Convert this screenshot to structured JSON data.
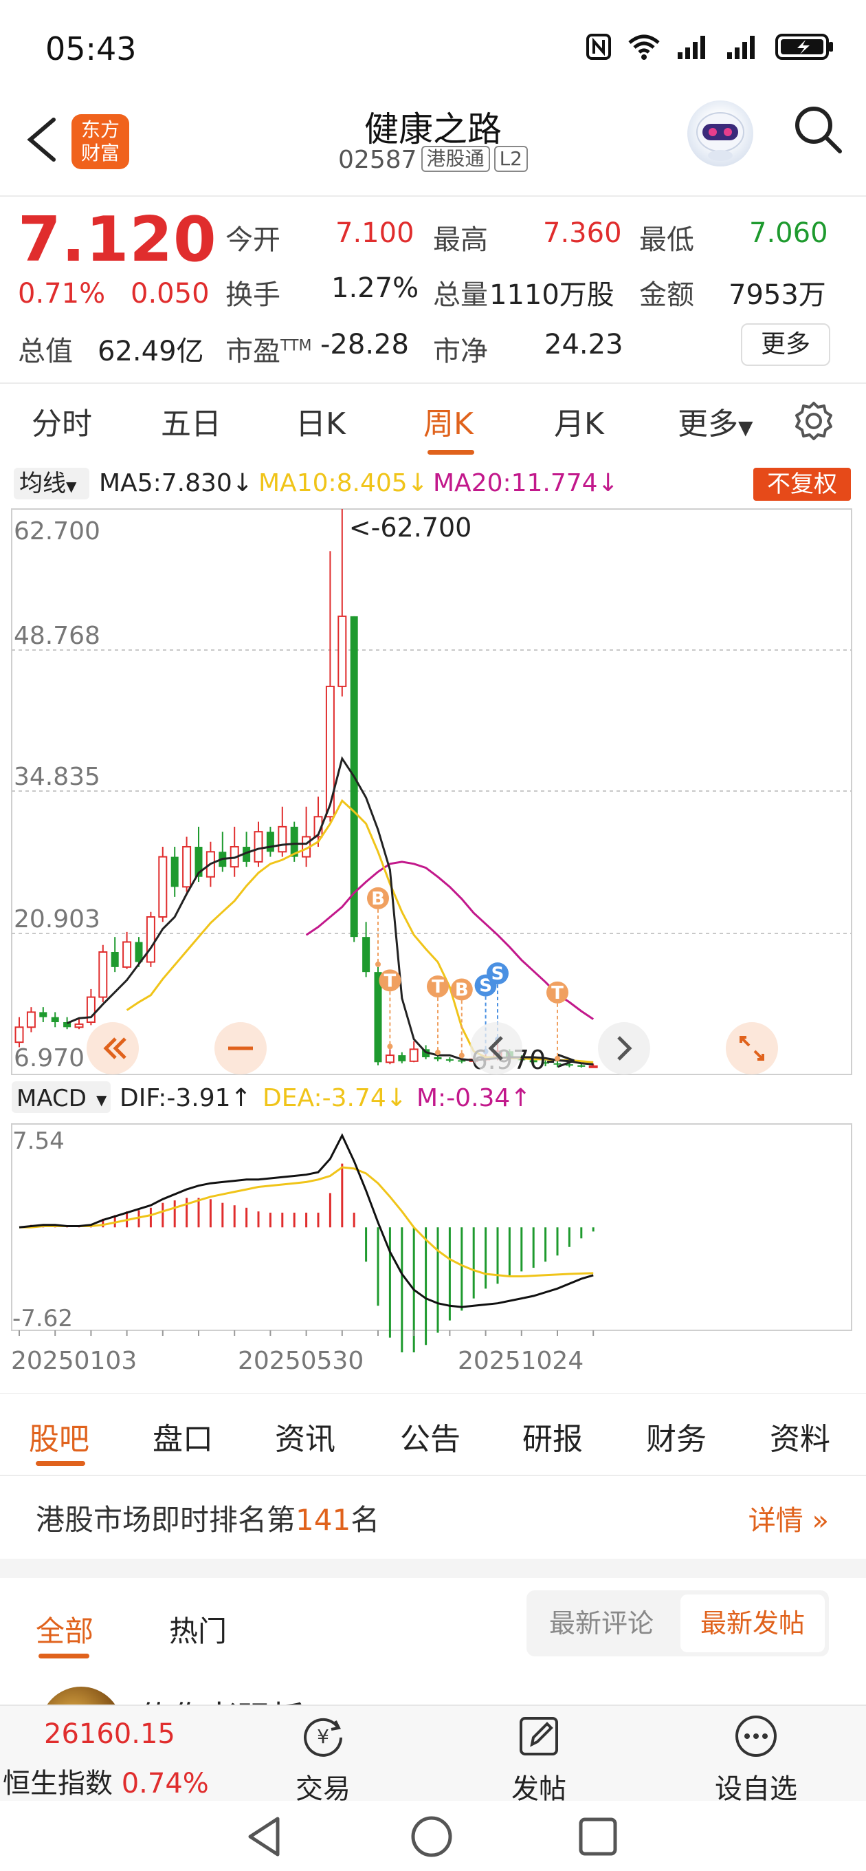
{
  "status_bar": {
    "time": "05:43"
  },
  "header": {
    "stock_name": "健康之路",
    "stock_code": "02587",
    "tag_connect": "港股通",
    "tag_level": "L2",
    "logo_text_1": "东方",
    "logo_text_2": "财富"
  },
  "quote": {
    "price": "7.120",
    "change_pct": "0.71%",
    "change_amt": "0.050",
    "open_label": "今开",
    "open_value": "7.100",
    "high_label": "最高",
    "high_value": "7.360",
    "low_label": "最低",
    "low_value": "7.060",
    "turnover_label": "换手",
    "turnover_value": "1.27%",
    "volume_label": "总量",
    "volume_value": "1110万股",
    "amount_label": "金额",
    "amount_value": "7953万",
    "mktcap_label": "总值",
    "mktcap_value": "62.49亿",
    "pe_label": "市盈",
    "pe_sup": "TTM",
    "pe_value": "-28.28",
    "pb_label": "市净",
    "pb_value": "24.23",
    "more_label": "更多"
  },
  "period_tabs": [
    "分时",
    "五日",
    "日K",
    "周K",
    "月K",
    "更多"
  ],
  "ma_legend": {
    "selector": "均线",
    "ma5": "MA5:7.830↓",
    "ma10": "MA10:8.405↓",
    "ma20": "MA20:11.774↓",
    "adjust_button": "不复权"
  },
  "macd_legend": {
    "selector": "MACD",
    "dif": "DIF:-3.91↑",
    "dea": "DEA:-3.74↓",
    "m": "M:-0.34↑"
  },
  "chart_data": {
    "type": "candlestick",
    "period": "weekly",
    "price_axis_labels": [
      "62.700",
      "48.768",
      "34.835",
      "20.903",
      "6.970"
    ],
    "ylim": [
      6.97,
      62.7
    ],
    "high_marker": "<-62.700",
    "low_marker": "6.970->",
    "date_labels": [
      "20250103",
      "20250530",
      "20251024"
    ],
    "colors": {
      "up": "#e02d2d",
      "down": "#1e9a2e",
      "ma5": "#222222",
      "ma10": "#f0c419",
      "ma20": "#c2188b"
    },
    "candles": [
      {
        "o": 9.5,
        "c": 11.0,
        "h": 12.0,
        "l": 9.0
      },
      {
        "o": 11.0,
        "c": 12.5,
        "h": 13.0,
        "l": 10.5
      },
      {
        "o": 12.5,
        "c": 12.0,
        "h": 13.0,
        "l": 11.5
      },
      {
        "o": 12.0,
        "c": 11.5,
        "h": 12.5,
        "l": 11.0
      },
      {
        "o": 11.5,
        "c": 11.0,
        "h": 12.0,
        "l": 10.8
      },
      {
        "o": 11.0,
        "c": 11.3,
        "h": 11.8,
        "l": 10.8
      },
      {
        "o": 11.5,
        "c": 14.0,
        "h": 14.8,
        "l": 11.2
      },
      {
        "o": 14.0,
        "c": 18.5,
        "h": 19.2,
        "l": 13.5
      },
      {
        "o": 18.5,
        "c": 17.0,
        "h": 20.0,
        "l": 16.5
      },
      {
        "o": 17.0,
        "c": 19.5,
        "h": 20.5,
        "l": 16.8
      },
      {
        "o": 19.5,
        "c": 17.5,
        "h": 20.0,
        "l": 17.0
      },
      {
        "o": 17.5,
        "c": 22.0,
        "h": 22.5,
        "l": 17.0
      },
      {
        "o": 22.0,
        "c": 28.0,
        "h": 29.0,
        "l": 21.5
      },
      {
        "o": 28.0,
        "c": 25.0,
        "h": 29.0,
        "l": 24.0
      },
      {
        "o": 25.0,
        "c": 29.0,
        "h": 30.0,
        "l": 24.5
      },
      {
        "o": 29.0,
        "c": 26.0,
        "h": 31.0,
        "l": 25.5
      },
      {
        "o": 26.0,
        "c": 28.5,
        "h": 29.5,
        "l": 25.0
      },
      {
        "o": 28.5,
        "c": 27.0,
        "h": 30.5,
        "l": 26.5
      },
      {
        "o": 27.0,
        "c": 29.0,
        "h": 31.0,
        "l": 26.0
      },
      {
        "o": 29.0,
        "c": 27.5,
        "h": 30.5,
        "l": 27.0
      },
      {
        "o": 27.5,
        "c": 30.5,
        "h": 31.5,
        "l": 27.0
      },
      {
        "o": 30.5,
        "c": 28.5,
        "h": 31.0,
        "l": 28.0
      },
      {
        "o": 28.5,
        "c": 31.0,
        "h": 33.0,
        "l": 28.0
      },
      {
        "o": 31.0,
        "c": 28.0,
        "h": 31.5,
        "l": 27.5
      },
      {
        "o": 28.0,
        "c": 30.0,
        "h": 33.0,
        "l": 27.0
      },
      {
        "o": 30.0,
        "c": 32.0,
        "h": 34.0,
        "l": 29.0
      },
      {
        "o": 32.0,
        "c": 45.0,
        "h": 58.5,
        "l": 31.5
      },
      {
        "o": 45.0,
        "c": 52.0,
        "h": 62.7,
        "l": 44.0
      },
      {
        "o": 52.0,
        "c": 20.0,
        "h": 52.0,
        "l": 19.5
      },
      {
        "o": 20.0,
        "c": 16.5,
        "h": 21.5,
        "l": 16.0
      },
      {
        "o": 16.5,
        "c": 7.5,
        "h": 17.0,
        "l": 7.2
      },
      {
        "o": 7.5,
        "c": 8.2,
        "h": 8.8,
        "l": 7.3
      },
      {
        "o": 8.2,
        "c": 7.6,
        "h": 8.5,
        "l": 7.4
      },
      {
        "o": 7.6,
        "c": 8.8,
        "h": 9.6,
        "l": 7.5
      },
      {
        "o": 8.8,
        "c": 8.0,
        "h": 9.2,
        "l": 7.8
      },
      {
        "o": 8.0,
        "c": 7.8,
        "h": 8.2,
        "l": 7.6
      },
      {
        "o": 7.8,
        "c": 7.7,
        "h": 8.0,
        "l": 7.5
      },
      {
        "o": 7.7,
        "c": 7.6,
        "h": 7.9,
        "l": 7.4
      },
      {
        "o": 7.6,
        "c": 7.8,
        "h": 8.1,
        "l": 7.4
      },
      {
        "o": 7.8,
        "c": 7.9,
        "h": 8.3,
        "l": 7.6
      },
      {
        "o": 7.9,
        "c": 8.6,
        "h": 9.5,
        "l": 7.7
      },
      {
        "o": 8.6,
        "c": 8.0,
        "h": 8.8,
        "l": 7.7
      },
      {
        "o": 8.0,
        "c": 7.7,
        "h": 8.2,
        "l": 7.5
      },
      {
        "o": 7.7,
        "c": 7.5,
        "h": 7.9,
        "l": 7.3
      },
      {
        "o": 7.5,
        "c": 7.4,
        "h": 7.7,
        "l": 7.1
      },
      {
        "o": 7.4,
        "c": 7.3,
        "h": 7.6,
        "l": 7.0
      },
      {
        "o": 7.3,
        "c": 7.2,
        "h": 7.5,
        "l": 7.0
      },
      {
        "o": 7.2,
        "c": 7.05,
        "h": 7.4,
        "l": 6.97
      },
      {
        "o": 7.07,
        "c": 7.12,
        "h": 7.36,
        "l": 7.06
      }
    ],
    "ma_lines": {
      "ma5": [
        null,
        null,
        null,
        null,
        11.4,
        11.9,
        12.0,
        13.3,
        14.5,
        15.7,
        17.3,
        18.9,
        20.8,
        22.0,
        24.3,
        26.4,
        27.3,
        27.8,
        27.9,
        28.4,
        28.8,
        29.0,
        29.2,
        29.3,
        29.3,
        30.2,
        33.2,
        37.8,
        36.0,
        33.9,
        30.7,
        26.7,
        13.9,
        9.8,
        8.5,
        8.2,
        8.2,
        7.8,
        7.7,
        7.8,
        7.9,
        8.0,
        8.0,
        8.0,
        7.9,
        7.7,
        7.6,
        7.4,
        7.3
      ],
      "ma10": [
        null,
        null,
        null,
        null,
        null,
        null,
        null,
        null,
        null,
        12.7,
        13.5,
        14.2,
        15.8,
        17.2,
        18.6,
        20.0,
        21.4,
        22.5,
        23.6,
        25.1,
        26.4,
        27.3,
        27.7,
        28.3,
        28.8,
        29.5,
        31.3,
        33.6,
        32.5,
        31.3,
        28.5,
        25.3,
        22.5,
        20.2,
        18.8,
        17.5,
        15.0,
        11.0,
        8.6,
        8.0,
        8.0,
        7.9,
        7.9,
        7.8,
        7.8,
        7.7,
        7.7,
        7.6,
        7.5
      ],
      "ma20": [
        null,
        null,
        null,
        null,
        null,
        null,
        null,
        null,
        null,
        null,
        null,
        null,
        null,
        null,
        null,
        null,
        null,
        null,
        null,
        20.2,
        21.0,
        22.0,
        23.0,
        24.4,
        25.5,
        26.5,
        27.3,
        27.5,
        27.3,
        26.9,
        26.0,
        25.0,
        23.8,
        22.4,
        21.3,
        20.2,
        19.0,
        17.7,
        16.6,
        15.5,
        14.3,
        13.5,
        12.6,
        11.8
      ]
    },
    "macd": {
      "ylim": [
        -7.62,
        7.54
      ],
      "axis_labels": [
        "7.54",
        "-7.62"
      ],
      "dif": [
        0.0,
        0.1,
        0.2,
        0.2,
        0.1,
        0.1,
        0.2,
        0.6,
        0.9,
        1.2,
        1.5,
        1.8,
        2.3,
        2.7,
        3.1,
        3.4,
        3.6,
        3.7,
        3.8,
        3.9,
        3.9,
        4.0,
        4.1,
        4.2,
        4.3,
        4.5,
        5.6,
        7.5,
        5.4,
        3.0,
        0.4,
        -2.0,
        -3.8,
        -5.1,
        -5.8,
        -6.2,
        -6.4,
        -6.5,
        -6.4,
        -6.3,
        -6.2,
        -6.0,
        -5.8,
        -5.6,
        -5.3,
        -5.0,
        -4.6,
        -4.2,
        -3.91
      ],
      "dea": [
        0.0,
        0.0,
        0.1,
        0.1,
        0.1,
        0.1,
        0.1,
        0.2,
        0.4,
        0.6,
        0.8,
        1.0,
        1.3,
        1.6,
        1.9,
        2.2,
        2.5,
        2.7,
        2.9,
        3.1,
        3.3,
        3.4,
        3.5,
        3.6,
        3.7,
        3.9,
        4.2,
        4.9,
        4.8,
        4.4,
        3.6,
        2.5,
        1.3,
        0.0,
        -1.0,
        -1.9,
        -2.6,
        -3.1,
        -3.5,
        -3.8,
        -3.9,
        -4.0,
        -4.0,
        -3.95,
        -3.9,
        -3.85,
        -3.8,
        -3.77,
        -3.74
      ],
      "hist": [
        0.0,
        0.2,
        0.2,
        0.2,
        0.1,
        0.1,
        0.2,
        0.7,
        1.0,
        1.3,
        1.4,
        1.6,
        2.0,
        2.2,
        2.4,
        2.4,
        2.3,
        2.0,
        1.8,
        1.6,
        1.3,
        1.2,
        1.2,
        1.2,
        1.2,
        1.2,
        2.8,
        5.2,
        1.2,
        -2.8,
        -6.4,
        -9.0,
        -10.2,
        -10.2,
        -9.6,
        -8.6,
        -7.6,
        -6.8,
        -5.8,
        -5.0,
        -4.6,
        -4.0,
        -3.6,
        -3.3,
        -2.8,
        -2.3,
        -1.6,
        -0.9,
        -0.34
      ]
    }
  },
  "chart_controls": {
    "trade_markers": [
      {
        "label": "B",
        "index": 30
      },
      {
        "label": "T",
        "index": 31
      },
      {
        "label": "T",
        "index": 35
      },
      {
        "label": "B",
        "index": 37
      },
      {
        "label": "S",
        "index": 39
      },
      {
        "label": "S",
        "index": 40
      },
      {
        "label": "T",
        "index": 45
      }
    ]
  },
  "content_tabs": [
    "股吧",
    "盘口",
    "资讯",
    "公告",
    "研报",
    "财务",
    "资料"
  ],
  "rank": {
    "prefix": "港股市场即时排名第",
    "number": "141",
    "suffix": "名",
    "detail": "详情"
  },
  "forum": {
    "filter_all": "全部",
    "filter_hot": "热门",
    "sort_comment": "最新评论",
    "sort_post": "最新发帖",
    "post_author_partial": "传伤老强板"
  },
  "bottom_bar": {
    "index_value": "26160.15",
    "index_name": "恒生指数",
    "index_pct": "0.74%",
    "trade_label": "交易",
    "trade_icon_glyph": "¥",
    "post_label": "发帖",
    "watchlist_label": "设自选"
  }
}
